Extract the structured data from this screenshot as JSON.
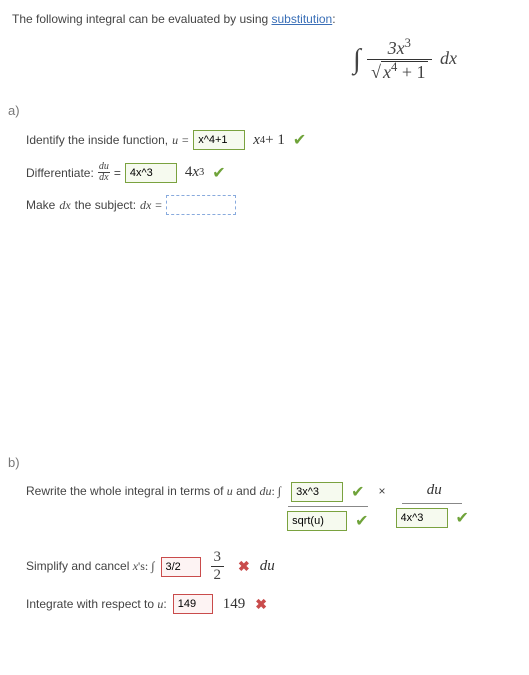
{
  "intro": {
    "prefix": "The following integral can be evaluated by using ",
    "link": "substitution",
    "suffix": ":"
  },
  "integral": {
    "numerator": "3x³",
    "denominator_inner": "x⁴ + 1",
    "dx": "dx"
  },
  "partA": {
    "label": "a)",
    "line1": {
      "text": "Identify the inside function, ",
      "uEq": "u =",
      "input": "x^4+1",
      "render": "x⁴ + 1"
    },
    "line2": {
      "text": "Differentiate: ",
      "frac_n": "du",
      "frac_d": "dx",
      "eq": " = ",
      "input": "4x^3",
      "render": "4x³"
    },
    "line3": {
      "prefix": "Make ",
      "dx": "dx",
      "suffix": " the subject: ",
      "dxEq": "dx ="
    }
  },
  "partB": {
    "label": "b)",
    "line1": {
      "text": "Rewrite the whole integral in terms of ",
      "u": "u",
      "and": " and ",
      "du": "du",
      "colon": ": ∫",
      "input_num": "3x^3",
      "input_den": "sqrt(u)",
      "du_label": "du",
      "input_right": "4x^3"
    },
    "line2": {
      "text": "Simplify and cancel ",
      "x": "x",
      "suffix": "'s: ∫",
      "input": "3/2",
      "frac_n": "3",
      "frac_d": "2",
      "du": "du"
    },
    "line3": {
      "text": "Integrate with respect to ",
      "u": "u",
      "colon": ":",
      "input": "149",
      "render": "149"
    }
  }
}
